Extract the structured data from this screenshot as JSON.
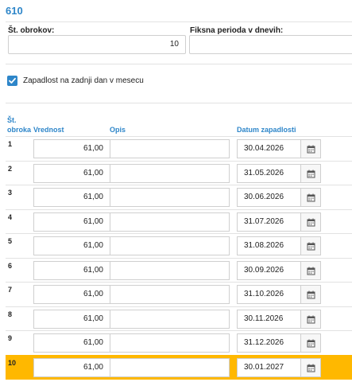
{
  "header": {
    "title": "610"
  },
  "fields": {
    "installments_label": "Št. obrokov:",
    "installments_value": "10",
    "fixed_period_label": "Fiksna perioda v dnevih:",
    "fixed_period_value": ""
  },
  "checkbox": {
    "label": "Zapadlost na zadnji dan v mesecu",
    "checked": true,
    "color": "#2e86c9"
  },
  "table": {
    "headers": {
      "number_line1": "Št.",
      "number_line2": "obroka",
      "value": "Vrednost",
      "description": "Opis",
      "due_date": "Datum zapadlosti"
    },
    "highlight_color": "#ffb800",
    "rows": [
      {
        "no": "1",
        "value": "61,00",
        "description": "",
        "due_date": "30.04.2026"
      },
      {
        "no": "2",
        "value": "61,00",
        "description": "",
        "due_date": "31.05.2026"
      },
      {
        "no": "3",
        "value": "61,00",
        "description": "",
        "due_date": "30.06.2026"
      },
      {
        "no": "4",
        "value": "61,00",
        "description": "",
        "due_date": "31.07.2026"
      },
      {
        "no": "5",
        "value": "61,00",
        "description": "",
        "due_date": "31.08.2026"
      },
      {
        "no": "6",
        "value": "61,00",
        "description": "",
        "due_date": "30.09.2026"
      },
      {
        "no": "7",
        "value": "61,00",
        "description": "",
        "due_date": "31.10.2026"
      },
      {
        "no": "8",
        "value": "61,00",
        "description": "",
        "due_date": "30.11.2026"
      },
      {
        "no": "9",
        "value": "61,00",
        "description": "",
        "due_date": "31.12.2026"
      },
      {
        "no": "10",
        "value": "61,00",
        "description": "",
        "due_date": "30.01.2027",
        "highlighted": true
      }
    ]
  },
  "icons": {
    "calendar": "calendar-icon",
    "checkmark": "checkmark-icon"
  }
}
